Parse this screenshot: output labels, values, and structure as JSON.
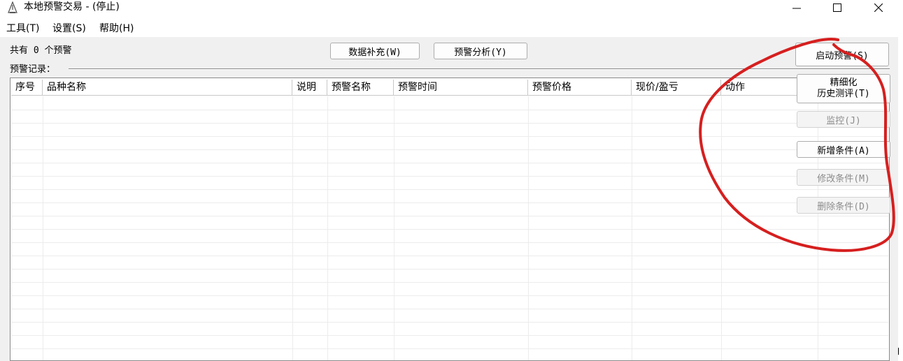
{
  "window": {
    "title": "本地预警交易 - (停止)",
    "icon": "triangle-alert-icon",
    "controls": [
      "minimize-icon",
      "maximize-icon",
      "close-icon"
    ]
  },
  "menu": [
    {
      "label": "工具(T)"
    },
    {
      "label": "设置(S)"
    },
    {
      "label": "帮助(H)"
    }
  ],
  "summary": {
    "count_text": "共有 0 个预警"
  },
  "toolbar": {
    "data_fill_label": "数据补充(W)",
    "alert_analysis_label": "预警分析(Y)"
  },
  "records": {
    "group_label": "预警记录：",
    "columns": [
      "序号",
      "品种名称",
      "说明",
      "预警名称",
      "预警时间",
      "预警价格",
      "现价/盈亏",
      "动作"
    ],
    "rows": []
  },
  "side_buttons": {
    "start_alert": "启动预警(S)",
    "refine_line1": "精细化",
    "refine_line2": "历史测评(T)",
    "monitor": "监控(J)",
    "add_condition": "新增条件(A)",
    "edit_condition": "修改条件(M)",
    "delete_condition": "删除条件(D)"
  },
  "colors": {
    "annotation": "#d61f1f",
    "window_bg": "#f0f0f0",
    "disabled_text": "#8c8c8c"
  }
}
